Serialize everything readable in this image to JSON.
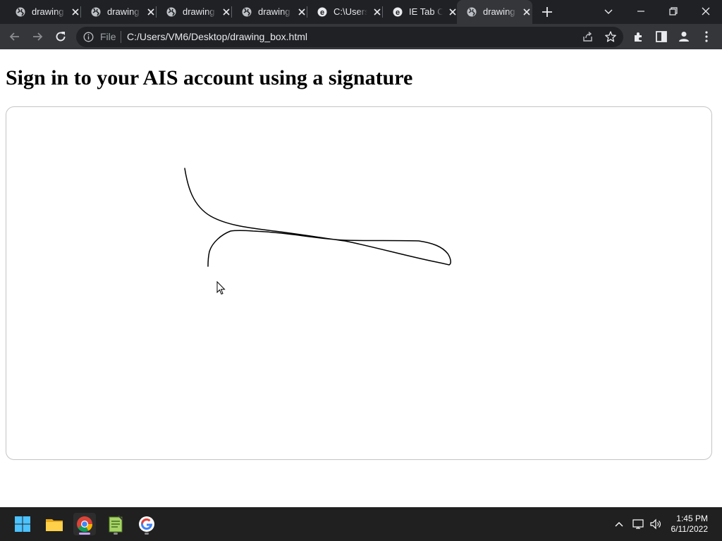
{
  "browser": {
    "tabs": [
      {
        "title": "drawing",
        "icon": "globe-icon",
        "active": false
      },
      {
        "title": "drawing",
        "icon": "globe-icon",
        "active": false
      },
      {
        "title": "drawing",
        "icon": "globe-icon",
        "active": false
      },
      {
        "title": "drawing",
        "icon": "globe-icon",
        "active": false
      },
      {
        "title": "C:\\Users",
        "icon": "ie-tab-icon",
        "active": false
      },
      {
        "title": "IE Tab O",
        "icon": "ie-tab-icon",
        "active": false
      },
      {
        "title": "drawing",
        "icon": "globe-icon",
        "active": true
      }
    ],
    "address_bar": {
      "scheme_label": "File",
      "url": "C:/Users/VM6/Desktop/drawing_box.html"
    },
    "colors": {
      "frame": "#202124",
      "toolbar": "#35363a",
      "text": "#e8eaed"
    }
  },
  "page": {
    "title": "Sign in to your AIS account using a signature",
    "signature_pad": {
      "has_signature": true,
      "stroke_color": "#000000"
    }
  },
  "taskbar": {
    "apps": [
      {
        "name": "start",
        "icon": "windows-start-icon",
        "running": false
      },
      {
        "name": "file-explorer",
        "icon": "folder-icon",
        "running": false
      },
      {
        "name": "chrome",
        "icon": "chrome-icon",
        "running": true
      },
      {
        "name": "notepad-plus",
        "icon": "notepad-icon",
        "running": false
      },
      {
        "name": "google",
        "icon": "google-icon",
        "running": false
      }
    ],
    "clock": {
      "time": "1:45 PM",
      "date": "6/11/2022"
    }
  }
}
